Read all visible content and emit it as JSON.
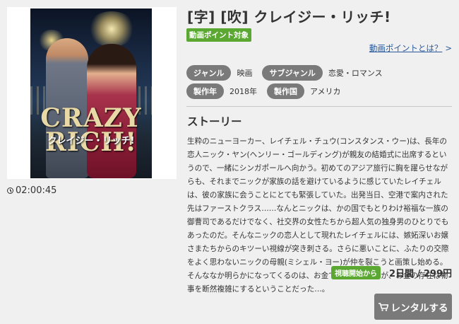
{
  "movie": {
    "title": "[字] [吹] クレイジー・リッチ!",
    "point_badge": "動画ポイント対象",
    "point_link": "動画ポイントとは？",
    "duration": "02:00:45",
    "poster": {
      "title_main": "CRAZY RICH!",
      "title_sub": "クレイジー・リッチ!"
    },
    "meta": {
      "genre_label": "ジャンル",
      "genre_value": "映画",
      "subgenre_label": "サブジャンル",
      "subgenre_value": "恋愛・ロマンス",
      "year_label": "製作年",
      "year_value": "2018年",
      "country_label": "製作国",
      "country_value": "アメリカ"
    },
    "story_heading": "ストーリー",
    "story": "生粋のニューヨーカー、レイチェル・チュウ(コンスタンス・ウー)は、長年の恋人ニック・ヤン(ヘンリー・ゴールディング)が親友の結婚式に出席するというので、一緒にシンガポールへ向かう。初めてのアジア旅行に胸を躍らせながらも、それまでニックが家族の話を避けているように感じていたレイチェルは、彼の家族に会うことにとても緊張していた。出発当日、空港で案内された先はファーストクラス……なんとニックは、かの国でもとりわけ裕福な一族の御曹司であるだけでなく、社交界の女性たちから超人気の独身男のひとりでもあったのだ。そんなニックの恋人として現れたレイチェルには、嫉妬深いお嬢さまたちからのキツーい視線が突き刺さる。さらに悪いことに、ふたりの交際をよく思わないニックの母親(ミシェル・ヨー)が仲を裂こうと画策し始める。そんななか明らかになってくるのは、お金で愛は買えないが、お金の存在は物事を断然複雑にするということだった…。",
    "price_badge": "視聴開始から",
    "price": "2日間 / 299円",
    "rent_button": "レンタルする"
  },
  "colors": {
    "badge_green": "#5aa832",
    "pill_gray": "#7a7a7a",
    "link_blue": "#2a5a9c"
  },
  "icons": [
    "clock-icon",
    "cart-icon",
    "chevron-right-icon"
  ]
}
